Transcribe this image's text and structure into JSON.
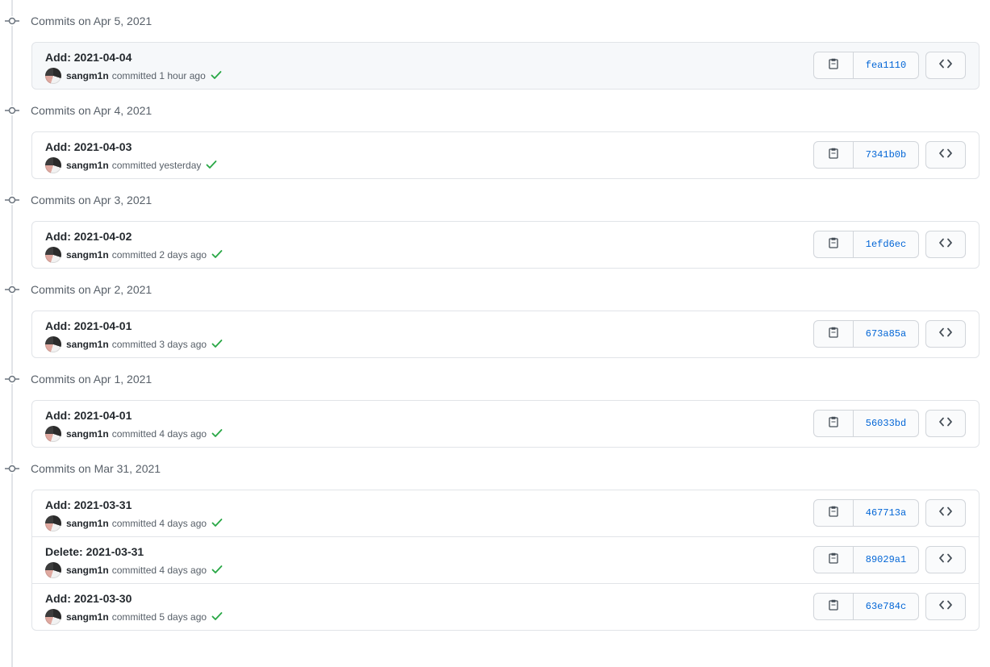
{
  "colors": {
    "accent": "#0366d6",
    "check": "#28a745",
    "border": "#e1e4e8",
    "muted": "#586069"
  },
  "icons": {
    "node": "git-commit-icon",
    "check": "check-icon",
    "copy": "clippy-icon",
    "browse": "code-icon"
  },
  "groups": [
    {
      "title": "Commits on Apr 5, 2021",
      "commits": [
        {
          "message": "Add: 2021-04-04",
          "author": "sangm1n",
          "action": "committed 1 hour ago",
          "sha": "fea1110",
          "highlight": true
        }
      ]
    },
    {
      "title": "Commits on Apr 4, 2021",
      "commits": [
        {
          "message": "Add: 2021-04-03",
          "author": "sangm1n",
          "action": "committed yesterday",
          "sha": "7341b0b"
        }
      ]
    },
    {
      "title": "Commits on Apr 3, 2021",
      "commits": [
        {
          "message": "Add: 2021-04-02",
          "author": "sangm1n",
          "action": "committed 2 days ago",
          "sha": "1efd6ec"
        }
      ]
    },
    {
      "title": "Commits on Apr 2, 2021",
      "commits": [
        {
          "message": "Add: 2021-04-01",
          "author": "sangm1n",
          "action": "committed 3 days ago",
          "sha": "673a85a"
        }
      ]
    },
    {
      "title": "Commits on Apr 1, 2021",
      "commits": [
        {
          "message": "Add: 2021-04-01",
          "author": "sangm1n",
          "action": "committed 4 days ago",
          "sha": "56033bd"
        }
      ]
    },
    {
      "title": "Commits on Mar 31, 2021",
      "commits": [
        {
          "message": "Add: 2021-03-31",
          "author": "sangm1n",
          "action": "committed 4 days ago",
          "sha": "467713a"
        },
        {
          "message": "Delete: 2021-03-31",
          "author": "sangm1n",
          "action": "committed 4 days ago",
          "sha": "89029a1"
        },
        {
          "message": "Add: 2021-03-30",
          "author": "sangm1n",
          "action": "committed 5 days ago",
          "sha": "63e784c"
        }
      ]
    }
  ]
}
